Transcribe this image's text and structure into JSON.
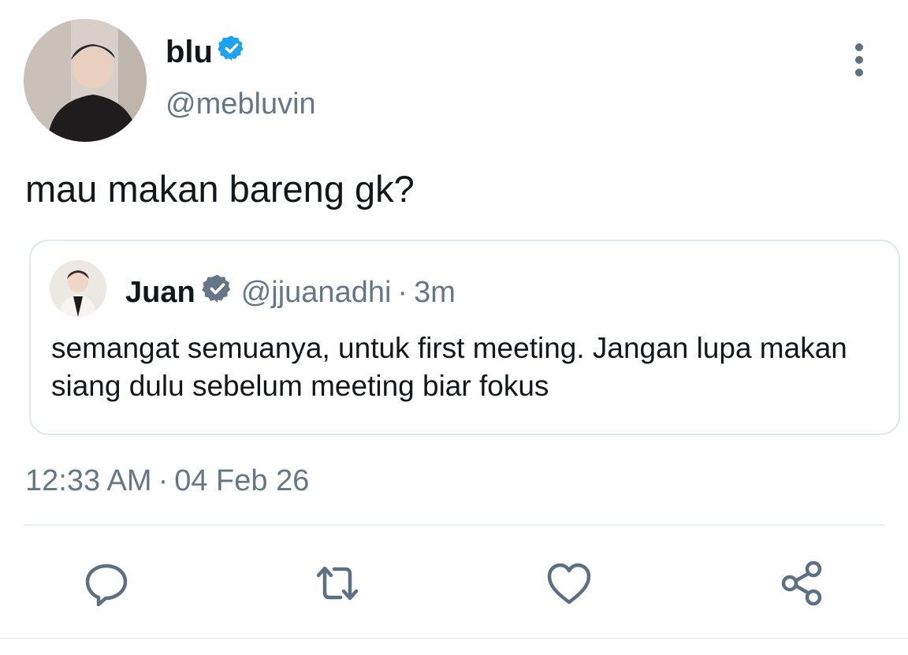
{
  "tweet": {
    "author": {
      "display_name": "blu",
      "username": "@mebluvin",
      "verified": true
    },
    "text": "mau makan bareng gk?",
    "timestamp": {
      "time": "12:33 AM",
      "separator": "·",
      "date": "04 Feb 26"
    }
  },
  "quoted_tweet": {
    "display_name": "Juan",
    "username": "@jjuanadhi",
    "separator": "·",
    "relative_time": "3m",
    "verified": true,
    "text": "semangat semuanya, untuk first meeting. Jangan lupa makan siang dulu sebelum meeting biar fokus"
  },
  "icons": {
    "more": "more-vertical-icon",
    "reply": "reply-icon",
    "retweet": "retweet-icon",
    "like": "heart-icon",
    "share": "share-icon",
    "verified": "verified-badge-icon"
  },
  "colors": {
    "text_primary": "#14171a",
    "text_secondary": "#657786",
    "icon": "#5b7083",
    "verified_blue": "#1da1f2",
    "verified_gray": "#657786",
    "border": "#e1e8ed"
  }
}
